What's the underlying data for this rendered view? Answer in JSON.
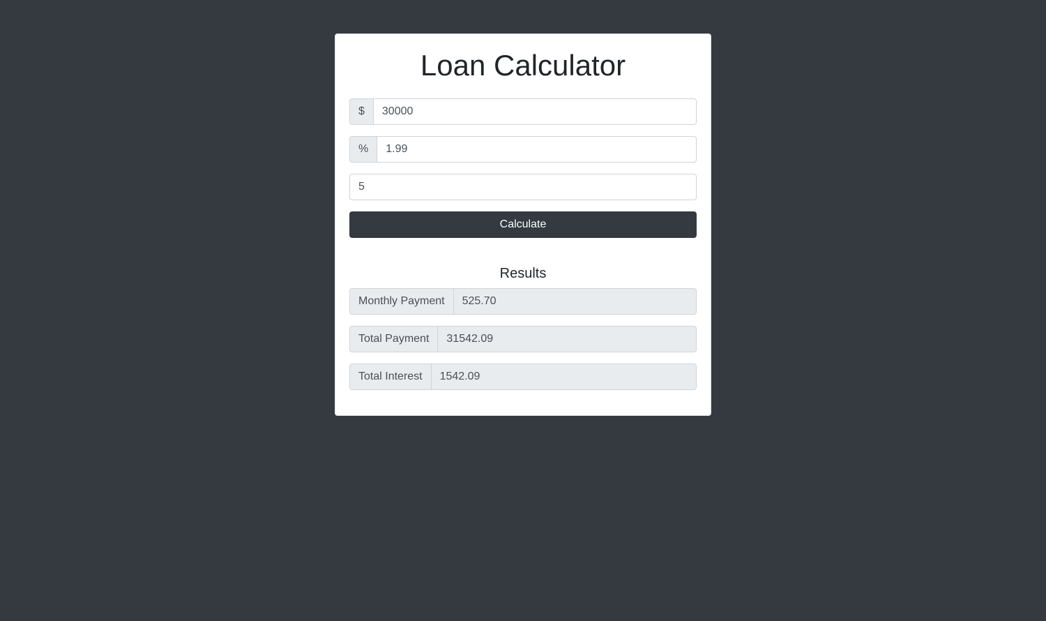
{
  "title": "Loan Calculator",
  "inputs": {
    "amount": {
      "prefix": "$",
      "value": "30000"
    },
    "interest": {
      "prefix": "%",
      "value": "1.99"
    },
    "years": {
      "value": "5"
    }
  },
  "calculate_label": "Calculate",
  "results": {
    "heading": "Results",
    "rows": [
      {
        "label": "Monthly Payment",
        "value": "525.70"
      },
      {
        "label": "Total Payment",
        "value": "31542.09"
      },
      {
        "label": "Total Interest",
        "value": "1542.09"
      }
    ]
  }
}
